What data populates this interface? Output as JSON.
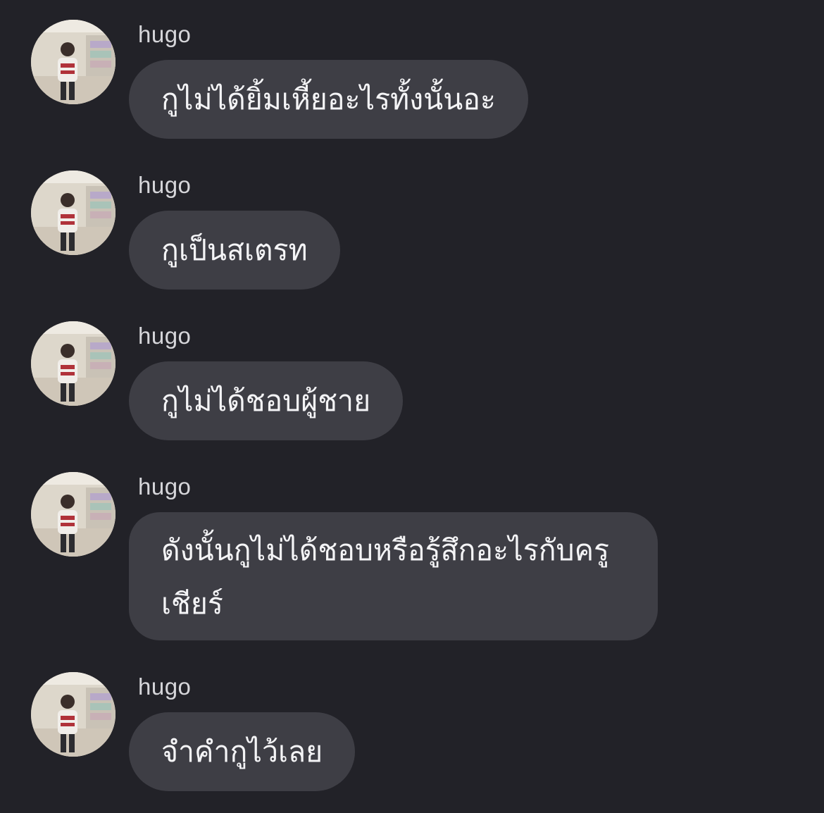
{
  "conversation": {
    "messages": [
      {
        "sender": "hugo",
        "text": "กูไม่ได้ยิ้มเหี้ยอะไรทั้งนั้นอะ",
        "avatar_icon": "user-avatar-photo"
      },
      {
        "sender": "hugo",
        "text": "กูเป็นสเตรท",
        "avatar_icon": "user-avatar-photo"
      },
      {
        "sender": "hugo",
        "text": "กูไม่ได้ชอบผู้ชาย",
        "avatar_icon": "user-avatar-photo"
      },
      {
        "sender": "hugo",
        "text": "ดังนั้นกูไม่ได้ชอบหรือรู้สึกอะไรกับครูเชียร์",
        "avatar_icon": "user-avatar-photo"
      },
      {
        "sender": "hugo",
        "text": "จำคำกูไว้เลย",
        "avatar_icon": "user-avatar-photo"
      }
    ]
  },
  "colors": {
    "background": "#222228",
    "bubble": "#3e3e45",
    "text": "#f4f4f6",
    "sender": "#d6d6da"
  }
}
